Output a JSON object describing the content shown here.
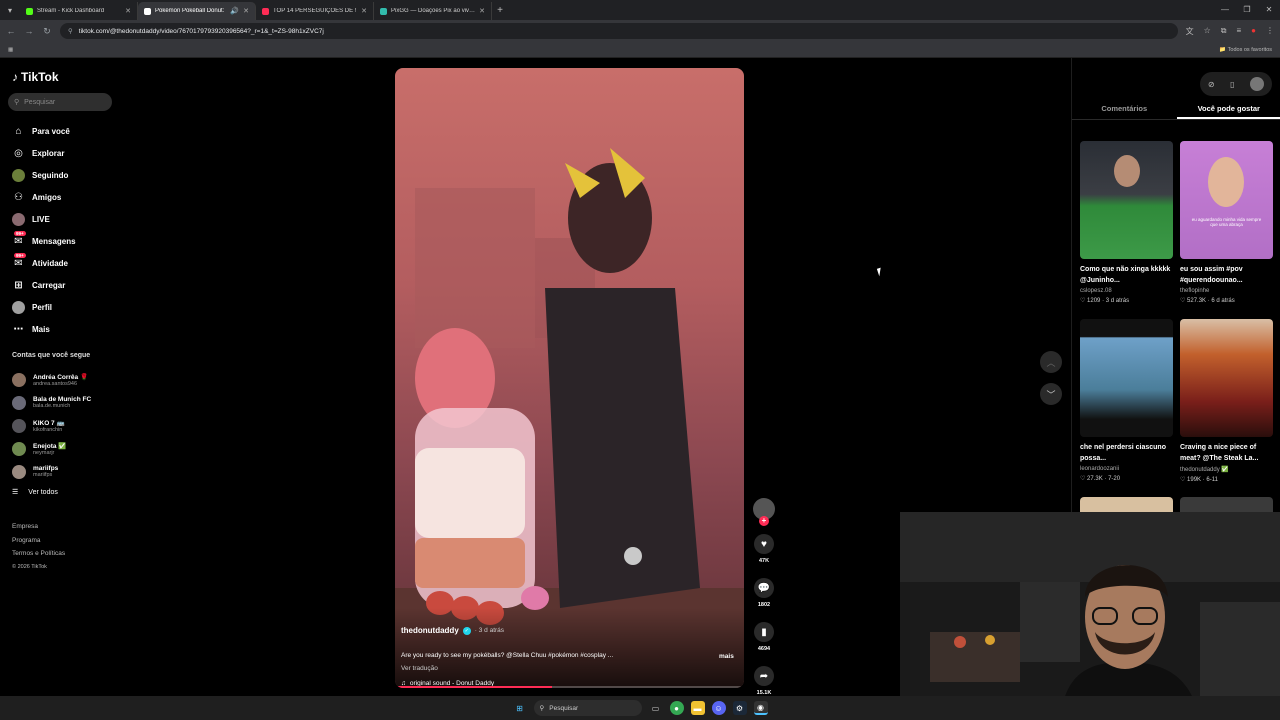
{
  "browser": {
    "tabs": [
      {
        "title": "Stream - Kick Dashboard",
        "color": "#53fc18"
      },
      {
        "title": "Pokémon Pokéball Donut:",
        "color": "#ffffff"
      },
      {
        "title": "TOP 14 PERSEGUIÇÕES DE !",
        "color": "#fe2c55"
      },
      {
        "title": "PixGG — Doações Pix ao vivo p",
        "color": "#32bcad"
      }
    ],
    "url": "tiktok.com/@thedonutdaddy/video/7670179793920396564?_r=1&_t=ZS-98h1xZVC7j",
    "bookmarks_label": "Todos os favoritos"
  },
  "sidebar": {
    "logo": "TikTok",
    "search_placeholder": "Pesquisar",
    "nav": [
      {
        "label": "Para você",
        "icon": "home-icon",
        "glyph": "⌂"
      },
      {
        "label": "Explorar",
        "icon": "compass-icon",
        "glyph": "◎"
      },
      {
        "label": "Seguindo",
        "icon": "following-icon",
        "glyph": "●"
      },
      {
        "label": "Amigos",
        "icon": "friends-icon",
        "glyph": "⚇"
      },
      {
        "label": "LIVE",
        "icon": "live-icon",
        "glyph": "●"
      },
      {
        "label": "Mensagens",
        "icon": "messages-icon",
        "glyph": "✉",
        "badge": "99+"
      },
      {
        "label": "Atividade",
        "icon": "activity-icon",
        "glyph": "✉",
        "badge": "99+"
      },
      {
        "label": "Carregar",
        "icon": "upload-icon",
        "glyph": "⊞"
      },
      {
        "label": "Perfil",
        "icon": "profile-icon",
        "glyph": "●"
      },
      {
        "label": "Mais",
        "icon": "more-icon",
        "glyph": "⋯"
      }
    ],
    "following_title": "Contas que você segue",
    "following": [
      {
        "name": "Andréa Corrêa 🌹",
        "handle": "andrea.santos946"
      },
      {
        "name": "Bala de Munich FC",
        "handle": "bala.de.munich"
      },
      {
        "name": "KIKO 7 🚌",
        "handle": "kikofranchin"
      },
      {
        "name": "Enejota ✅",
        "handle": "neymarjr"
      },
      {
        "name": "mariifps",
        "handle": "mariifps"
      }
    ],
    "see_all": "Ver todos",
    "footer": [
      "Empresa",
      "Programa",
      "Termos e Políticas"
    ],
    "copyright": "© 2026 TikTok"
  },
  "video": {
    "author": "thedonutdaddy",
    "time": "· 3 d atrás",
    "caption": "Are you ready to see my pokéballs? @Stella Chuu #pokémon #cosplay ...",
    "more": "mais",
    "translate": "Ver tradução",
    "sound": "original sound - Donut Daddy",
    "progress": 0.45
  },
  "actions": {
    "likes": "47K",
    "comments": "1802",
    "saves": "4694",
    "shares": "15.1K"
  },
  "right_panel": {
    "tabs": [
      "Comentários",
      "Você pode gostar"
    ],
    "cards": [
      {
        "title": "Como que não xinga kkkkk @Juninho...",
        "author": "cslopesz.08",
        "likes": "♡ 1209",
        "time": "3 d atrás"
      },
      {
        "title": "eu sou assim #pov #querendoounao...",
        "author": "theflopinhe",
        "likes": "♡ 527.3K",
        "time": "6 d atrás"
      },
      {
        "title": "che nel perdersi ciascuno possa...",
        "author": "leonardoozanii",
        "likes": "♡ 27.3K",
        "time": "7-20"
      },
      {
        "title": "Craving a nice piece of meat? @The Steak La...",
        "author": "thedonutdaddy ✅",
        "likes": "♡ 199K",
        "time": "6-11"
      }
    ],
    "thumb_caption": "eu aguardando minha vida sempre que uma abraça"
  },
  "taskbar": {
    "search": "Pesquisar"
  }
}
